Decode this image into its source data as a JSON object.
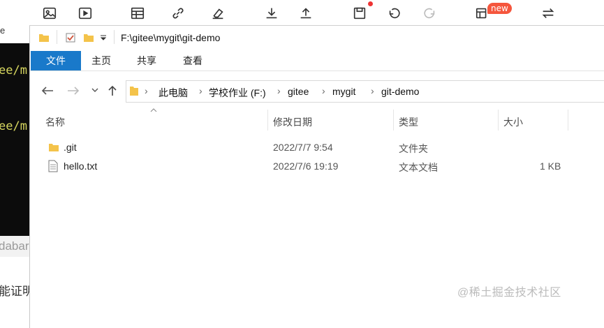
{
  "background": {
    "left_snippet_top": "e",
    "terminal_lines": [
      "ee/m",
      "ee/m"
    ],
    "left_snippet_mid": "dabar",
    "left_snippet_low": "能证明"
  },
  "toolbar": {
    "icons": [
      "image-icon",
      "video-icon",
      "table-icon",
      "link-icon",
      "eraser-icon",
      "download-icon",
      "upload-icon",
      "save-icon",
      "undo-icon",
      "redo-icon",
      "template-icon",
      "switch-icon"
    ],
    "new_badge": "new"
  },
  "window": {
    "title_path": "F:\\gitee\\mygit\\git-demo",
    "tabs": [
      "文件",
      "主页",
      "共享",
      "查看"
    ],
    "breadcrumbs": [
      "此电脑",
      "学校作业 (F:)",
      "gitee",
      "mygit",
      "git-demo"
    ],
    "columns": [
      "名称",
      "修改日期",
      "类型",
      "大小"
    ],
    "files": [
      {
        "name": ".git",
        "date": "2022/7/7 9:54",
        "type": "文件夹",
        "size": ""
      },
      {
        "name": "hello.txt",
        "date": "2022/7/6 19:19",
        "type": "文本文档",
        "size": "1 KB"
      }
    ]
  },
  "watermark": "@稀土掘金技术社区",
  "colors": {
    "accent": "#1979ca",
    "folder": "#f4c34a",
    "terminal_text": "#d7d75f",
    "badge": "#f5563d"
  }
}
